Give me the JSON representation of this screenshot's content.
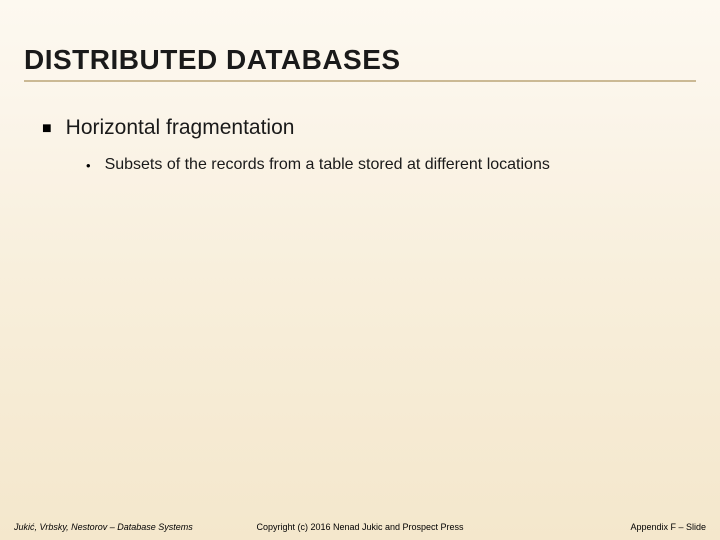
{
  "title": "DISTRIBUTED DATABASES",
  "bullets": {
    "l1": "Horizontal fragmentation",
    "l2": "Subsets of the records from a table stored at different locations"
  },
  "footer": {
    "left": "Jukić, Vrbsky, Nestorov – Database Systems",
    "center": "Copyright (c) 2016 Nenad Jukic and Prospect Press",
    "right": "Appendix F – Slide"
  }
}
